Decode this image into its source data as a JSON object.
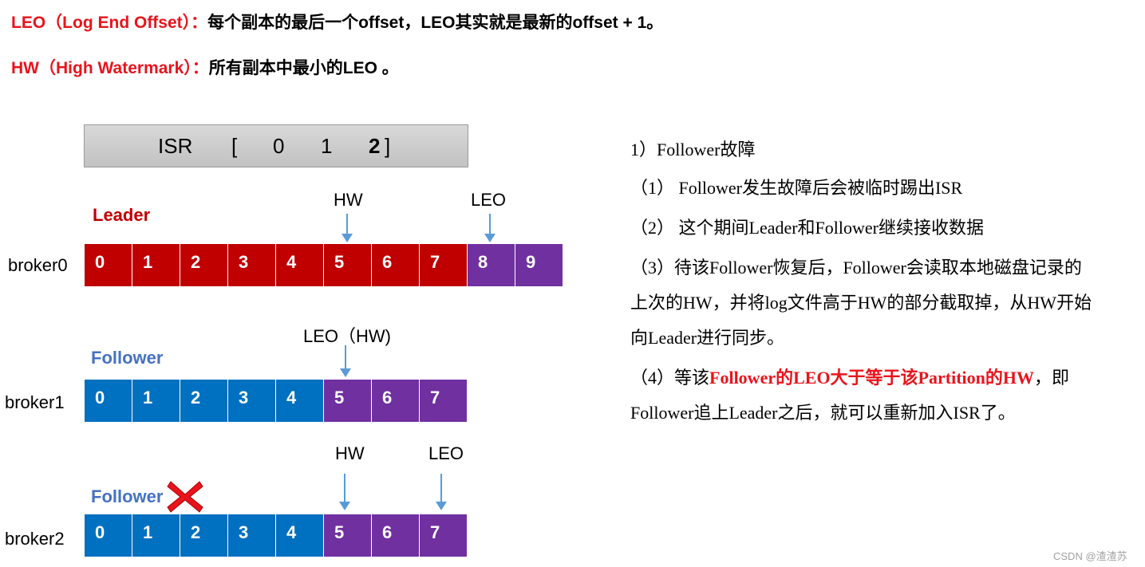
{
  "definitions": [
    {
      "term": "LEO（Log End Offset）：",
      "text": "每个副本的最后一个offset，LEO其实就是最新的offset + 1。"
    },
    {
      "term": "HW（High Watermark）：",
      "text": "所有副本中最小的LEO 。"
    }
  ],
  "isr": {
    "label": "ISR",
    "open": "[",
    "members": [
      "0",
      "1",
      "2"
    ],
    "close": "]"
  },
  "brokers": [
    {
      "name": "broker0",
      "role": "Leader",
      "cells": [
        "0",
        "1",
        "2",
        "3",
        "4",
        "5",
        "6",
        "7",
        "8",
        "9"
      ],
      "cell_colors": [
        "red",
        "red",
        "red",
        "red",
        "red",
        "red",
        "red",
        "red",
        "purple",
        "purple"
      ],
      "markers": [
        {
          "label": "HW",
          "offset": 5
        },
        {
          "label": "LEO",
          "offset": 8
        }
      ]
    },
    {
      "name": "broker1",
      "role": "Follower",
      "cells": [
        "0",
        "1",
        "2",
        "3",
        "4",
        "5",
        "6",
        "7"
      ],
      "cell_colors": [
        "blue",
        "blue",
        "blue",
        "blue",
        "blue",
        "purple",
        "purple",
        "purple"
      ],
      "markers": [
        {
          "label": "LEO（HW)",
          "offset": 5
        }
      ]
    },
    {
      "name": "broker2",
      "role": "Follower",
      "failed": true,
      "cells": [
        "0",
        "1",
        "2",
        "3",
        "4",
        "5",
        "6",
        "7"
      ],
      "cell_colors": [
        "blue",
        "blue",
        "blue",
        "blue",
        "blue",
        "purple",
        "purple",
        "purple"
      ],
      "markers": [
        {
          "label": "HW",
          "offset": 5
        },
        {
          "label": "LEO",
          "offset": 7
        }
      ]
    }
  ],
  "notes": {
    "heading": "1）Follower故障",
    "items": [
      "（1） Follower发生故障后会被临时踢出ISR",
      "（2） 这个期间Leader和Follower继续接收数据",
      "（3）待该Follower恢复后，Follower会读取本地磁盘记录的",
      "上次的HW，并将log文件高于HW的部分截取掉，从HW开始",
      "向Leader进行同步。"
    ],
    "item4": {
      "prefix": "（4）等该",
      "highlight": "Follower的LEO大于等于该Partition的HW",
      "suffix": "，即"
    },
    "item4_cont": "Follower追上Leader之后，就可以重新加入ISR了。"
  },
  "colors": {
    "leader": "#c00000",
    "follower_blue": "#0070c0",
    "purple": "#7030a0",
    "arrow": "#5b9bd5",
    "term_red": "#e8141b"
  },
  "watermark": "CSDN @渣渣苏"
}
